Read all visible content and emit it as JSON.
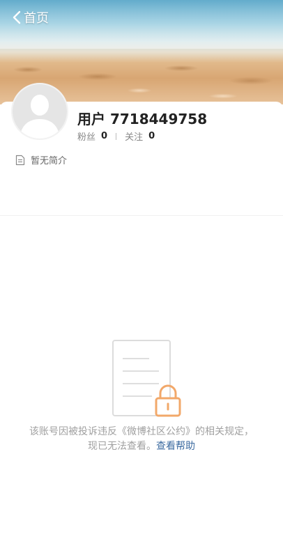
{
  "header": {
    "back_label": "首页"
  },
  "profile": {
    "username": "用户 7718449758",
    "followers_label": "粉丝",
    "followers_count": "0",
    "following_label": "关注",
    "following_count": "0",
    "bio": "暂无简介"
  },
  "notice": {
    "text": "该账号因被投诉违反《微博社区公约》的相关规定，现已无法查看。",
    "help_link": "查看帮助"
  },
  "colors": {
    "link": "#3b6aa0",
    "lock": "#f2a86a",
    "muted": "#a0a0a0"
  },
  "icons": [
    "chevron-left-icon",
    "document-icon",
    "lock-icon",
    "avatar-placeholder"
  ]
}
